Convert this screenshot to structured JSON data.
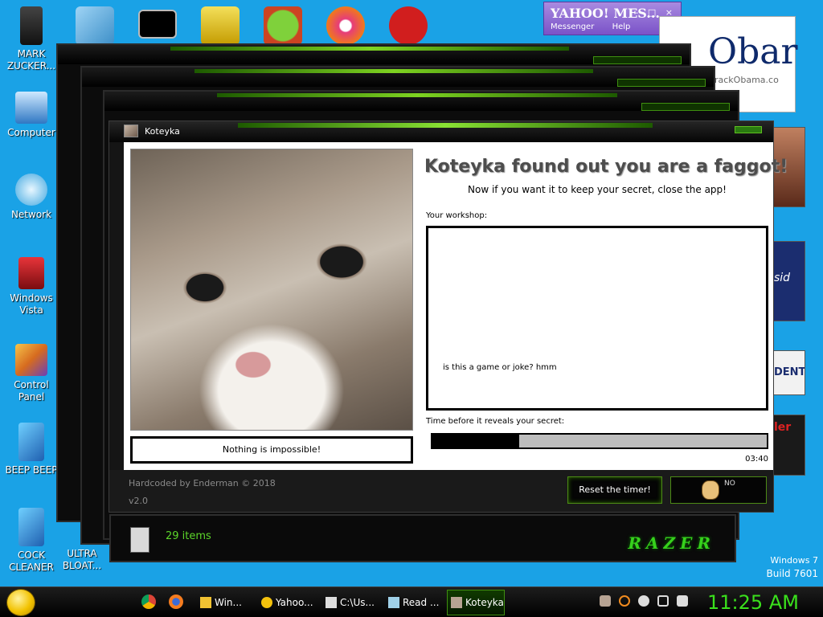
{
  "desktop_icons": [
    {
      "label": "MARK ZUCKER..."
    },
    {
      "label": "Computer"
    },
    {
      "label": "Network"
    },
    {
      "label": "Windows Vista"
    },
    {
      "label": "Control Panel"
    },
    {
      "label": "BEEP BEEP"
    },
    {
      "label": "COCK CLEANER"
    },
    {
      "label": "ULTRA BLOAT..."
    }
  ],
  "yahoo": {
    "title": "YAHOO! MES...",
    "menu1": "Messenger",
    "menu2": "Help",
    "controls": "– □ ×"
  },
  "obama_widget": {
    "big": "Obar",
    "small": "rackObama.co"
  },
  "side_labels": {
    "dent": "DENT",
    "pres": "sid",
    "ler": "ler"
  },
  "window": {
    "title": "Koteyka",
    "headline": "Koteyka found out you are a faggot!",
    "subheadline": "Now if you want it to keep your secret, close the app!",
    "workshop_label": "Your workshop:",
    "workshop_text": "is this a game or joke? hmm",
    "timer_label": "Time before it reveals your secret:",
    "timer_value": "03:40",
    "progress_fraction": 0.26,
    "caption": "Nothing is impossible!",
    "credit": "Hardcoded by Enderman © 2018",
    "version": "v2.0",
    "reset_button": "Reset the timer!",
    "baldi_text": "NO"
  },
  "explorer": {
    "items_count": "29 items",
    "brand": "RAZER"
  },
  "build": {
    "os": "Windows 7",
    "build": "Build 7601"
  },
  "taskbar": {
    "buttons": [
      {
        "label": "Win..."
      },
      {
        "label": "Yahoo..."
      },
      {
        "label": "C:\\Us..."
      },
      {
        "label": "Read ..."
      },
      {
        "label": "Koteyka"
      }
    ],
    "clock": "11:25 AM"
  },
  "colors": {
    "accent_green": "#3ae01c",
    "desktop_blue": "#1aa2e6"
  }
}
